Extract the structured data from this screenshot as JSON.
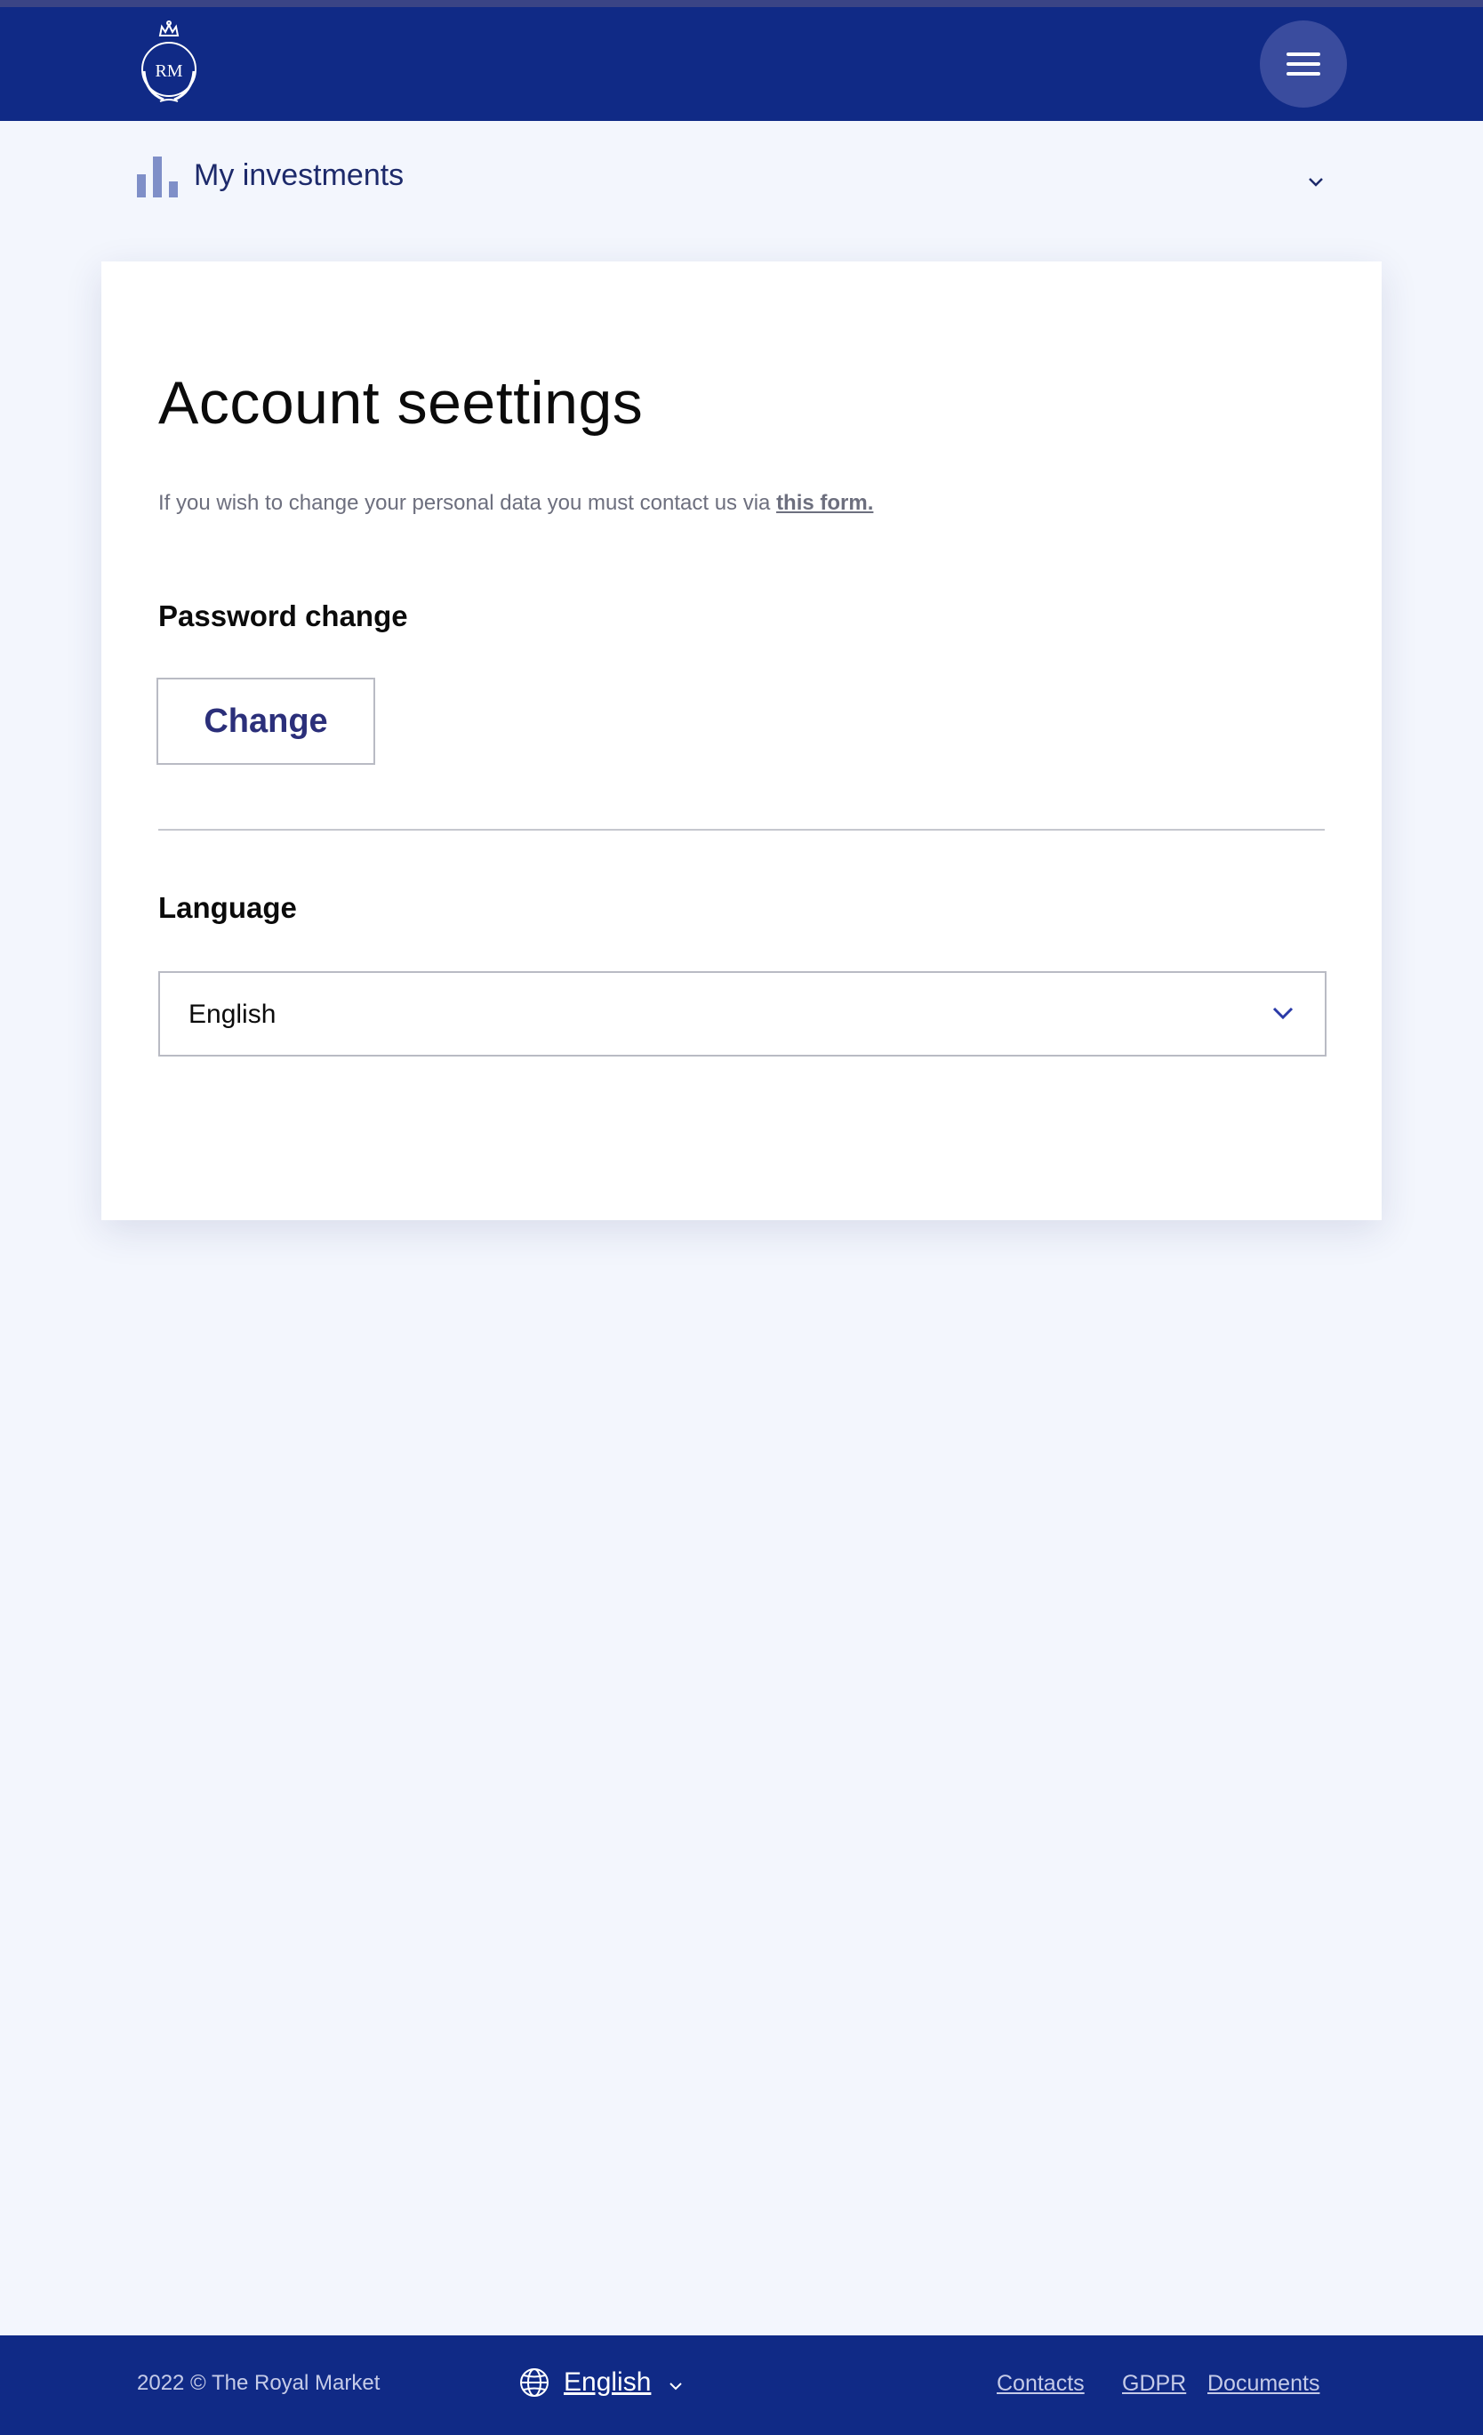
{
  "header": {
    "logo_monogram": "RM"
  },
  "subnav": {
    "label": "My investments"
  },
  "settings": {
    "title": "Account seettings",
    "intro_text": "If you wish to change your personal data you must contact us via ",
    "intro_link": "this form.",
    "password_section": {
      "heading": "Password change",
      "button_label": "Change"
    },
    "language_section": {
      "heading": "Language",
      "selected": "English"
    }
  },
  "footer": {
    "copyright": "2022 © The Royal Market",
    "language": "English",
    "links": [
      "Contacts",
      "GDPR",
      "Documents"
    ]
  },
  "colors": {
    "header_bg": "#102a86",
    "page_bg": "#f3f6fd",
    "accent": "#2b2f7a",
    "bar_icon": "#7f8fc8"
  },
  "icons": {
    "logo": "crown-wreath-logo-icon",
    "menu": "hamburger-menu-icon",
    "investments": "bar-chart-icon",
    "dropdown": "chevron-down-icon",
    "language": "globe-icon"
  }
}
